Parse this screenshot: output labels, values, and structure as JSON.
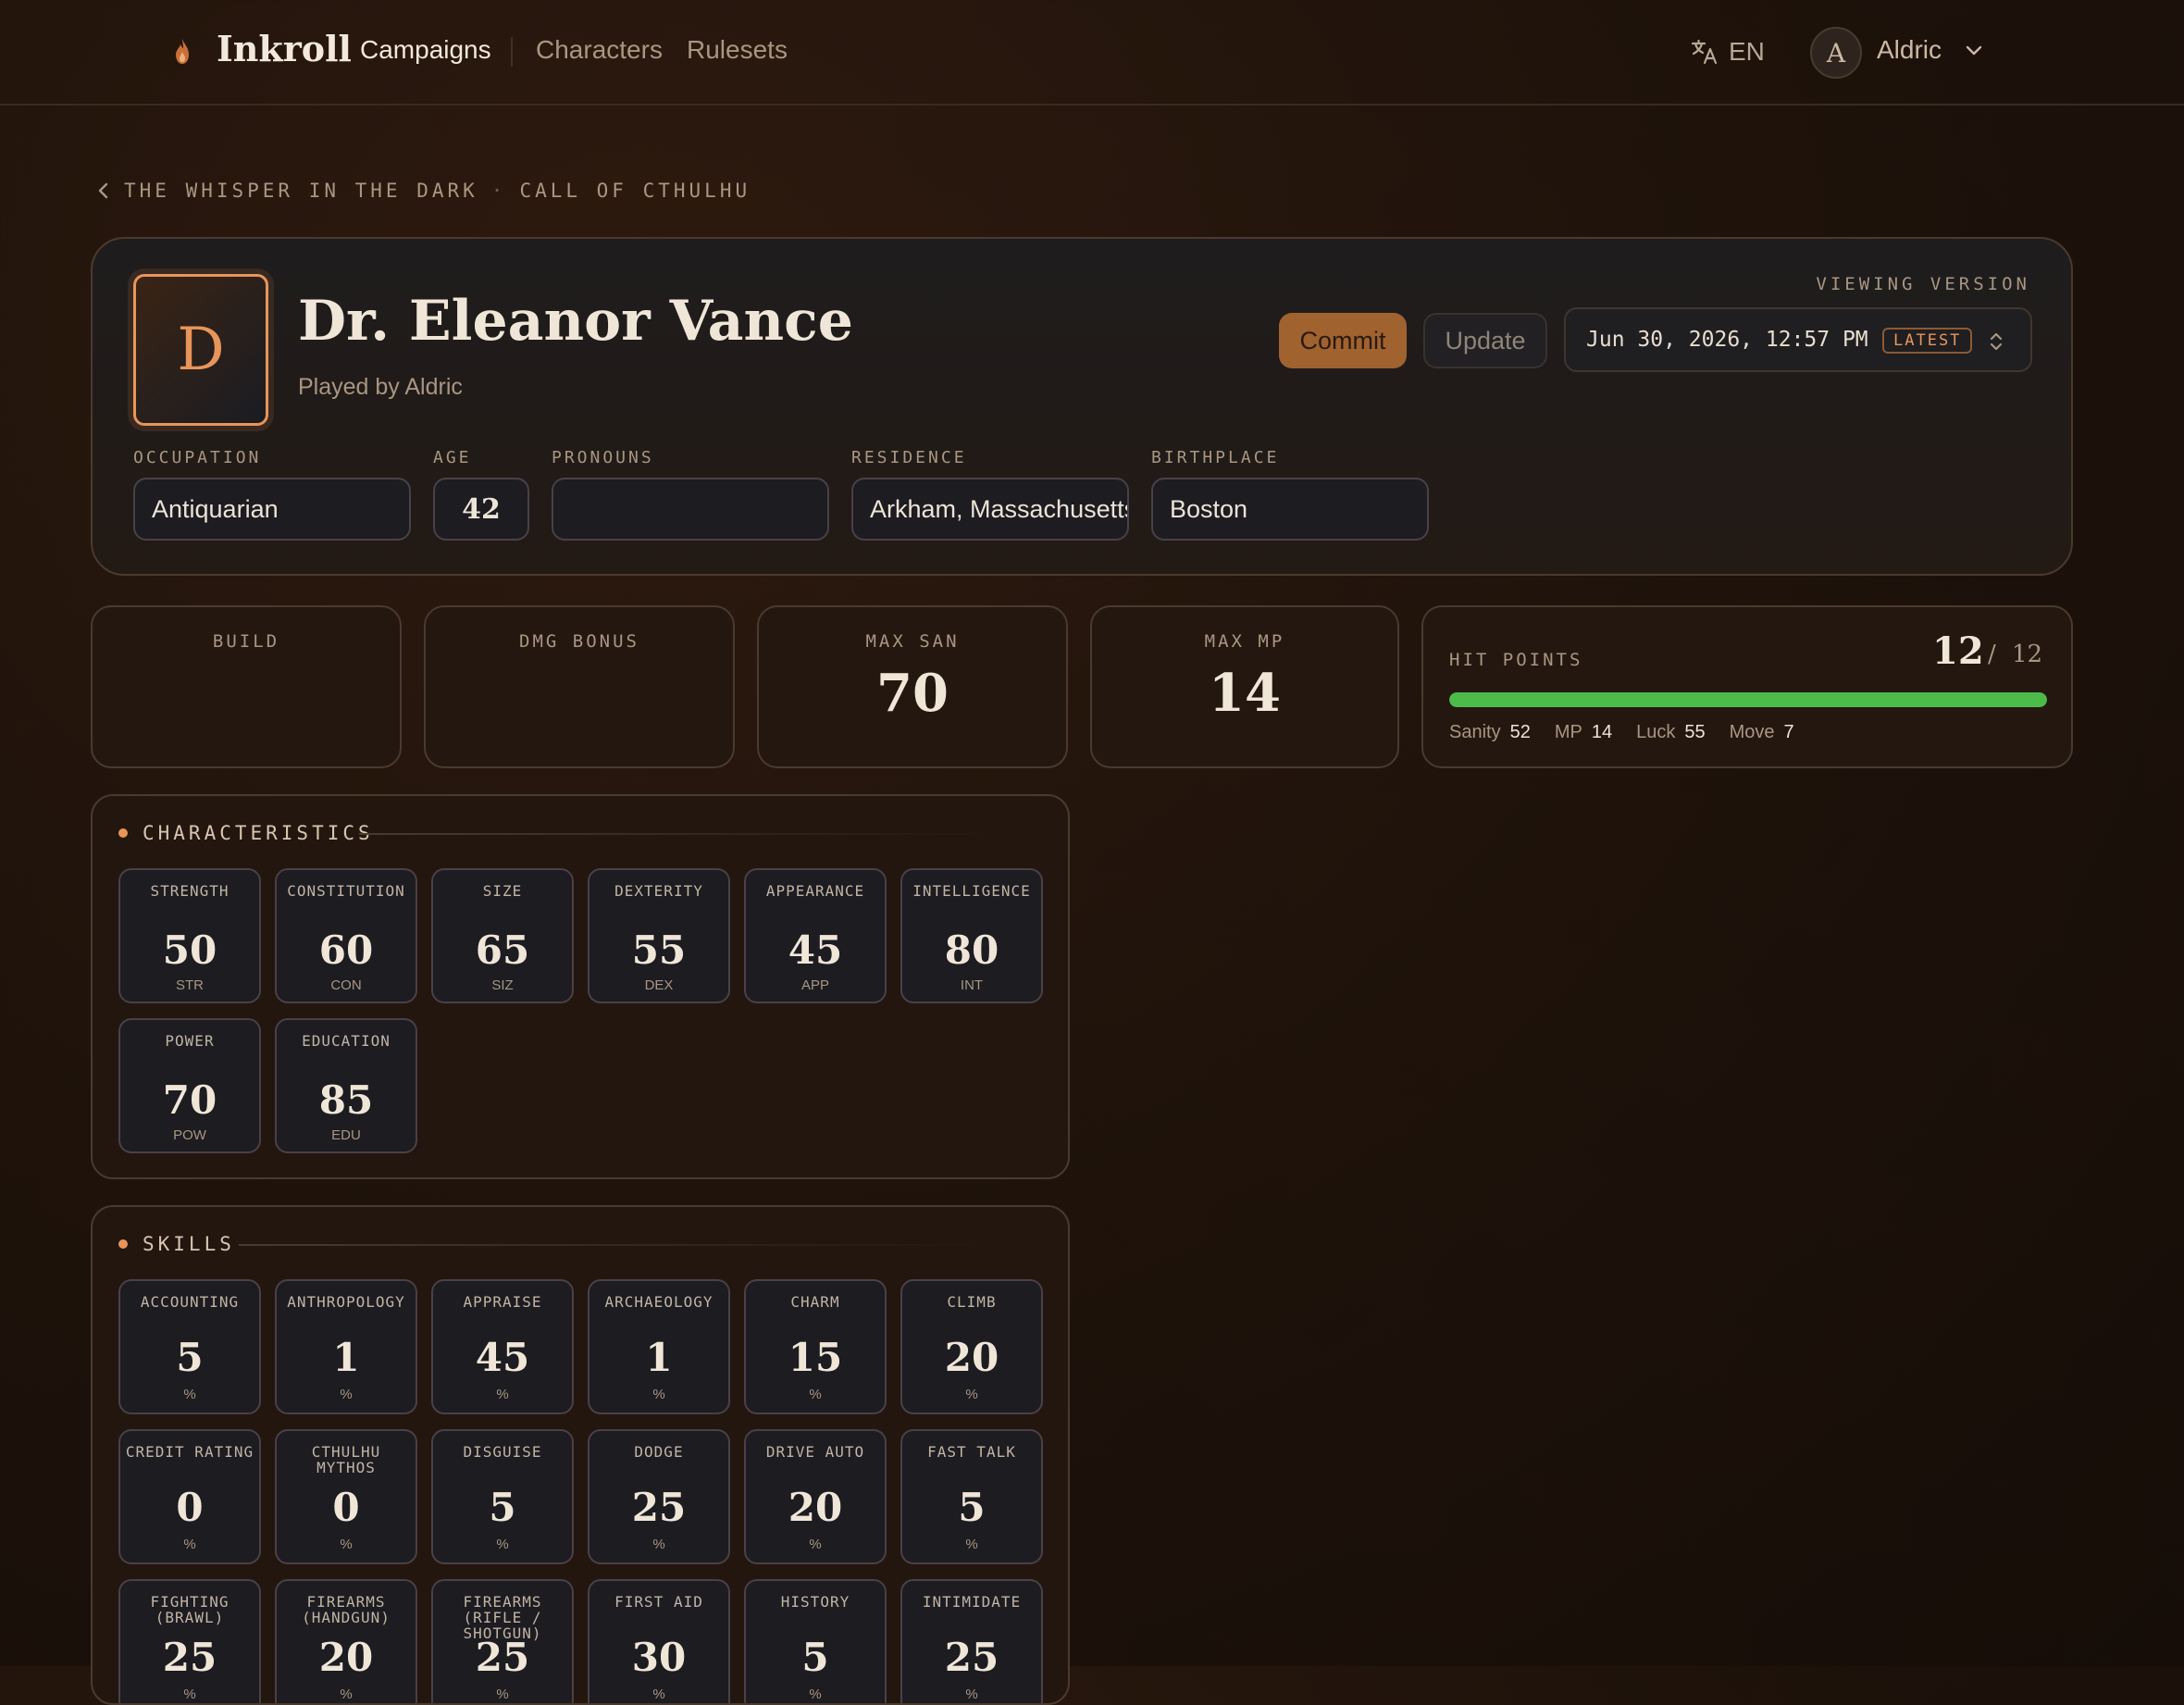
{
  "nav": {
    "brand": "Inkroll",
    "items": [
      "Campaigns",
      "Characters",
      "Rulesets"
    ],
    "active": 0,
    "language": "EN",
    "user_initial": "A",
    "user_name": "Aldric"
  },
  "breadcrumb": {
    "campaign": "THE WHISPER IN THE DARK",
    "separator": "·",
    "system": "CALL OF CTHULHU"
  },
  "character": {
    "initial": "D",
    "name": "Dr. Eleanor Vance",
    "played_by": "Played by Aldric"
  },
  "version": {
    "label": "VIEWING VERSION",
    "commit_label": "Commit",
    "update_label": "Update",
    "date": "Jun 30, 2026, 12:57 PM",
    "badge": "LATEST"
  },
  "fields": {
    "occupation": {
      "label": "OCCUPATION",
      "value": "Antiquarian"
    },
    "age": {
      "label": "AGE",
      "value": "42"
    },
    "pronouns": {
      "label": "PRONOUNS",
      "value": ""
    },
    "residence": {
      "label": "RESIDENCE",
      "value": "Arkham, Massachusetts"
    },
    "birthplace": {
      "label": "BIRTHPLACE",
      "value": "Boston"
    }
  },
  "stats": {
    "build": {
      "label": "BUILD",
      "value": ""
    },
    "dmg_bonus": {
      "label": "DMG BONUS",
      "value": ""
    },
    "max_san": {
      "label": "MAX SAN",
      "value": "70"
    },
    "max_mp": {
      "label": "MAX MP",
      "value": "14"
    }
  },
  "hit_points": {
    "label": "HIT POINTS",
    "current": "12",
    "separator": "/",
    "max": "12",
    "fill_fraction": 1.0,
    "bar_color": "#4cbb4a",
    "sanity_label": "Sanity",
    "sanity": "52",
    "mp_label": "MP",
    "mp": "14",
    "luck_label": "Luck",
    "luck": "55",
    "move_label": "Move",
    "move": "7"
  },
  "characteristics": {
    "title": "CHARACTERISTICS",
    "items": [
      {
        "name": "STRENGTH",
        "value": "50",
        "abbr": "STR"
      },
      {
        "name": "CONSTITUTION",
        "value": "60",
        "abbr": "CON"
      },
      {
        "name": "SIZE",
        "value": "65",
        "abbr": "SIZ"
      },
      {
        "name": "DEXTERITY",
        "value": "55",
        "abbr": "DEX"
      },
      {
        "name": "APPEARANCE",
        "value": "45",
        "abbr": "APP"
      },
      {
        "name": "INTELLIGENCE",
        "value": "80",
        "abbr": "INT"
      },
      {
        "name": "POWER",
        "value": "70",
        "abbr": "POW"
      },
      {
        "name": "EDUCATION",
        "value": "85",
        "abbr": "EDU"
      }
    ]
  },
  "skills": {
    "title": "SKILLS",
    "unit": "%",
    "items": [
      {
        "name": "ACCOUNTING",
        "value": "5"
      },
      {
        "name": "ANTHROPOLOGY",
        "value": "1"
      },
      {
        "name": "APPRAISE",
        "value": "45"
      },
      {
        "name": "ARCHAEOLOGY",
        "value": "1"
      },
      {
        "name": "CHARM",
        "value": "15"
      },
      {
        "name": "CLIMB",
        "value": "20"
      },
      {
        "name": "CREDIT RATING",
        "value": "0"
      },
      {
        "name": "CTHULHU MYTHOS",
        "value": "0"
      },
      {
        "name": "DISGUISE",
        "value": "5"
      },
      {
        "name": "DODGE",
        "value": "25"
      },
      {
        "name": "DRIVE AUTO",
        "value": "20"
      },
      {
        "name": "FAST TALK",
        "value": "5"
      },
      {
        "name": "FIGHTING (BRAWL)",
        "value": "25"
      },
      {
        "name": "FIREARMS (HANDGUN)",
        "value": "20"
      },
      {
        "name": "FIREARMS (RIFLE / SHOTGUN)",
        "value": "25"
      },
      {
        "name": "FIRST AID",
        "value": "30"
      },
      {
        "name": "HISTORY",
        "value": "5"
      },
      {
        "name": "INTIMIDATE",
        "value": "25"
      }
    ]
  },
  "colors": {
    "accent": "#e8955a",
    "commit_bg": "#a0622f",
    "background": "#1f130b"
  },
  "icons": {
    "logo": "flame-icon",
    "language": "translate-icon",
    "user_menu": "chevron-down-icon",
    "back": "chevron-left-icon",
    "version_select": "up-down-chevron-icon"
  }
}
